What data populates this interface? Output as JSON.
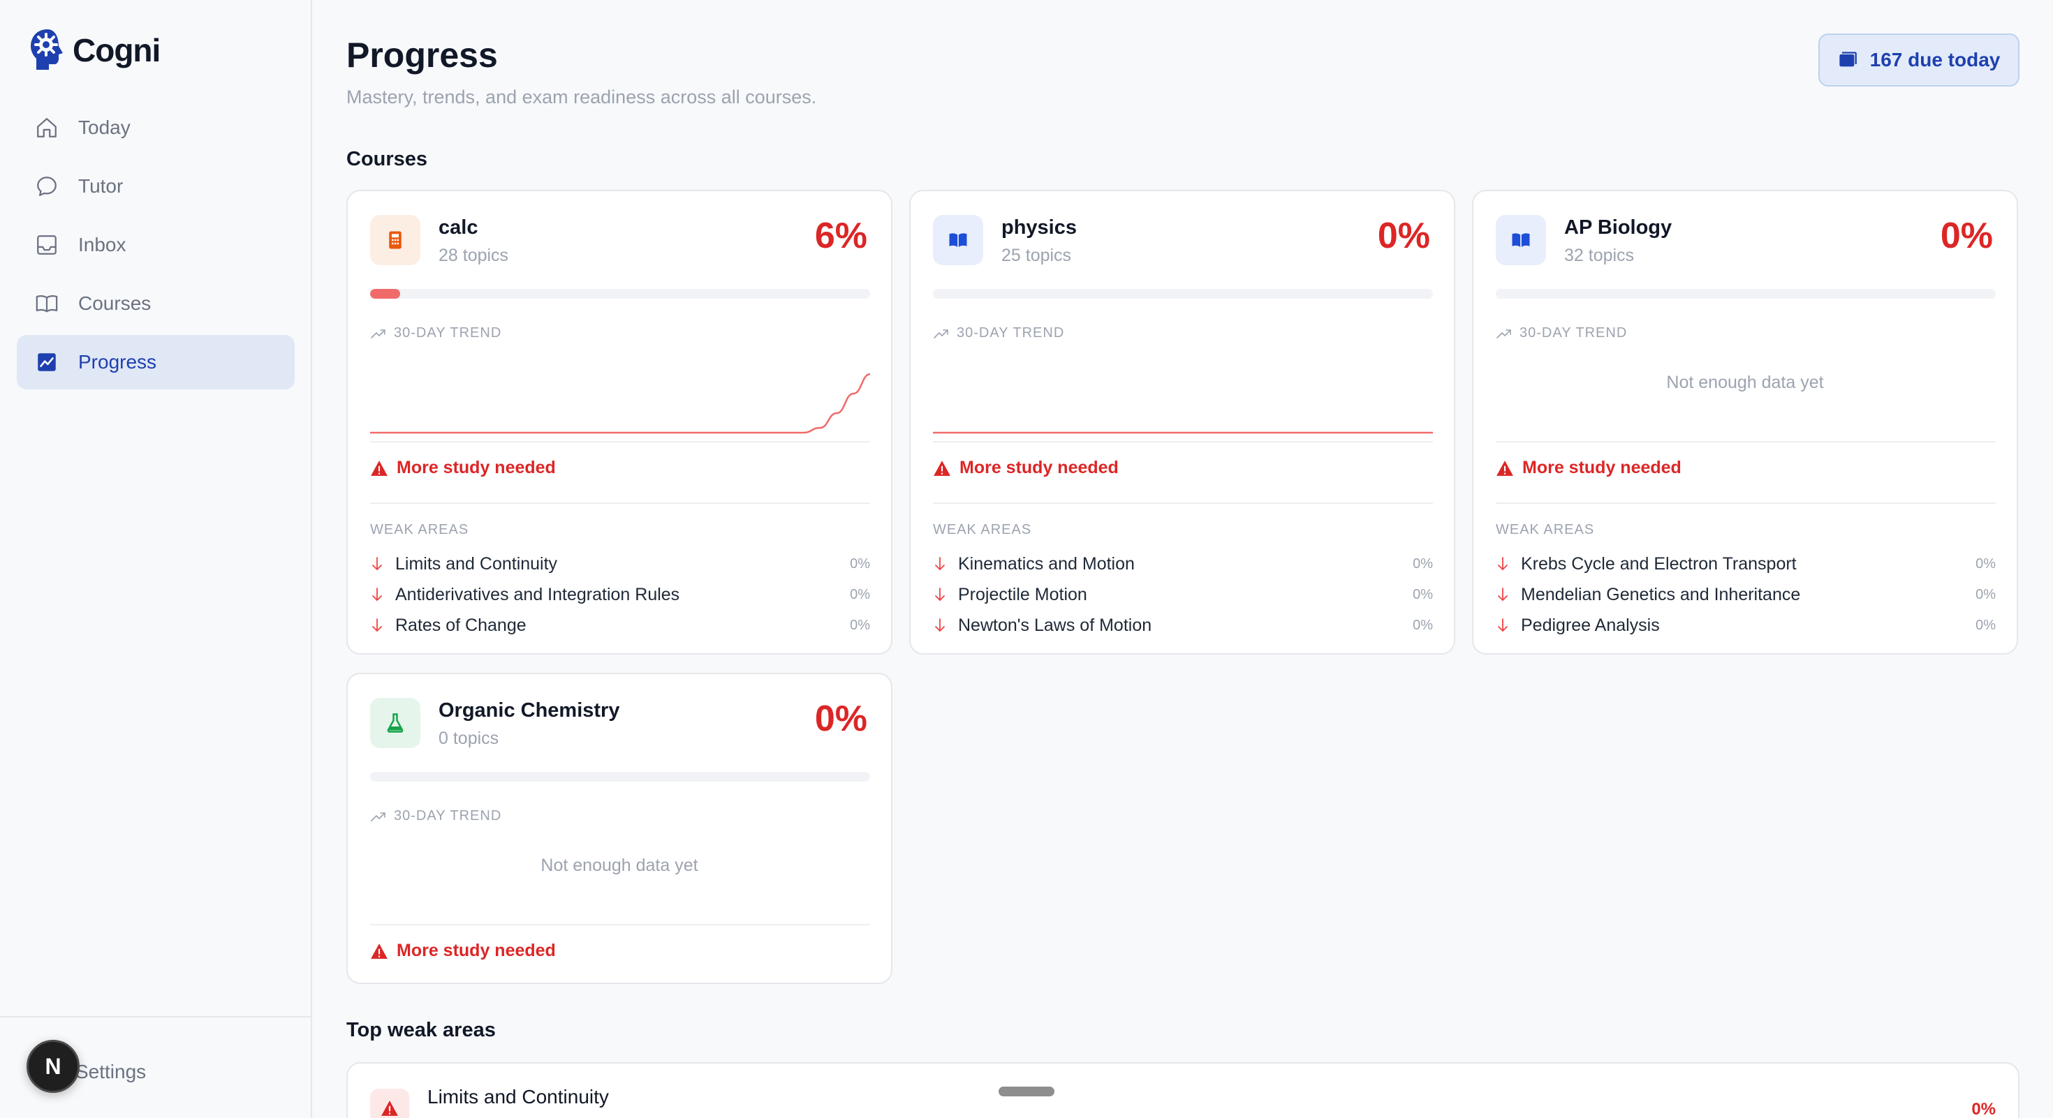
{
  "brand": {
    "name": "Cogni"
  },
  "nav": [
    {
      "label": "Today",
      "icon": "home-icon",
      "active": false
    },
    {
      "label": "Tutor",
      "icon": "chat-bubble-icon",
      "active": false
    },
    {
      "label": "Inbox",
      "icon": "inbox-icon",
      "active": false
    },
    {
      "label": "Courses",
      "icon": "book-open-icon",
      "active": false
    },
    {
      "label": "Progress",
      "icon": "chart-icon",
      "active": true
    }
  ],
  "sidebar_bottom": {
    "settings_label": "Settings",
    "avatar_letter": "N"
  },
  "header": {
    "title": "Progress",
    "subtitle": "Mastery, trends, and exam readiness across all courses.",
    "due_button": "167 due today"
  },
  "sections": {
    "courses": "Courses",
    "top_weak": "Top weak areas"
  },
  "labels": {
    "trend": "30-DAY TREND",
    "no_data": "Not enough data yet",
    "warning": "More study needed",
    "weak_areas": "WEAK AREAS"
  },
  "colors": {
    "accent": "#1e40af",
    "danger": "#dc2626",
    "bar": "#f06a6a"
  },
  "courses": [
    {
      "name": "calc",
      "topics": "28 topics",
      "pct": "6%",
      "mastery": 0.06,
      "icon": "calculator-icon",
      "icon_bg": "#fdeee4",
      "icon_color": "#ea580c",
      "trend": [
        0,
        0,
        0,
        0,
        0,
        0,
        0,
        0,
        0,
        0,
        0,
        0,
        0,
        0,
        0,
        0,
        0,
        0,
        0,
        0,
        0,
        0,
        0,
        0,
        0,
        0,
        0,
        0.5,
        2,
        4,
        6
      ],
      "weak": [
        {
          "name": "Limits and Continuity",
          "pct": "0%"
        },
        {
          "name": "Antiderivatives and Integration Rules",
          "pct": "0%"
        },
        {
          "name": "Rates of Change",
          "pct": "0%"
        }
      ]
    },
    {
      "name": "physics",
      "topics": "25 topics",
      "pct": "0%",
      "mastery": 0,
      "icon": "book-icon",
      "icon_bg": "#e8eefc",
      "icon_color": "#1d4ed8",
      "trend": [
        0,
        0,
        0,
        0,
        0,
        0,
        0,
        0,
        0,
        0,
        0,
        0,
        0,
        0,
        0,
        0,
        0,
        0,
        0,
        0,
        0,
        0,
        0,
        0,
        0,
        0,
        0,
        0,
        0,
        0,
        0
      ],
      "weak": [
        {
          "name": "Kinematics and Motion",
          "pct": "0%"
        },
        {
          "name": "Projectile Motion",
          "pct": "0%"
        },
        {
          "name": "Newton's Laws of Motion",
          "pct": "0%"
        }
      ]
    },
    {
      "name": "AP Biology",
      "topics": "32 topics",
      "pct": "0%",
      "mastery": 0,
      "icon": "book-icon",
      "icon_bg": "#e8eefc",
      "icon_color": "#1d4ed8",
      "trend": null,
      "weak": [
        {
          "name": "Krebs Cycle and Electron Transport",
          "pct": "0%"
        },
        {
          "name": "Mendelian Genetics and Inheritance",
          "pct": "0%"
        },
        {
          "name": "Pedigree Analysis",
          "pct": "0%"
        }
      ]
    },
    {
      "name": "Organic Chemistry",
      "topics": "0 topics",
      "pct": "0%",
      "mastery": 0,
      "icon": "flask-icon",
      "icon_bg": "#e6f5ec",
      "icon_color": "#16a34a",
      "trend": null,
      "weak": []
    }
  ],
  "top_weak": [
    {
      "name": "Limits and Continuity",
      "pct": "0%"
    }
  ]
}
